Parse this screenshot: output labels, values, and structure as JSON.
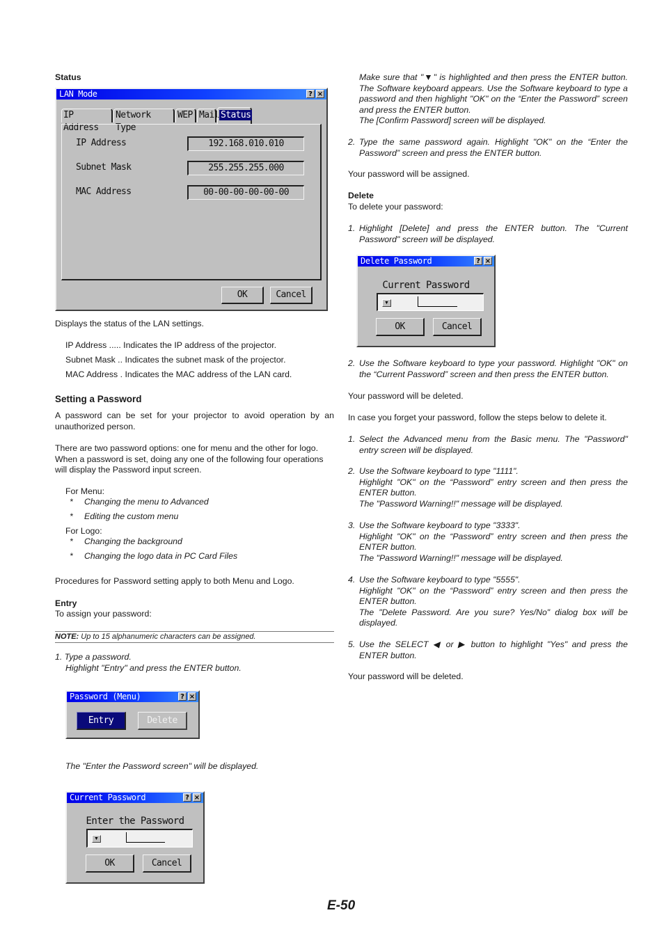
{
  "left": {
    "status_heading": "Status",
    "lan_window": {
      "title": "LAN Mode",
      "help_icon": "?",
      "close_icon": "×",
      "tabs": [
        {
          "label": "IP Address",
          "selected": false
        },
        {
          "label": "Network Type",
          "selected": false
        },
        {
          "label": "WEP",
          "selected": false
        },
        {
          "label": "Mail",
          "selected": false
        },
        {
          "label": "Status",
          "selected": true
        }
      ],
      "rows": [
        {
          "label": "IP Address",
          "value": "192.168.010.010"
        },
        {
          "label": "Subnet Mask",
          "value": "255.255.255.000"
        },
        {
          "label": "MAC Address",
          "value": "00-00-00-00-00-00"
        }
      ],
      "ok_label": "OK",
      "cancel_label": "Cancel"
    },
    "status_desc": "Displays the status of the LAN settings.",
    "defs": [
      {
        "term": "IP Address .....",
        "desc": "Indicates the IP address of the projector."
      },
      {
        "term": "Subnet Mask ..",
        "desc": "Indicates the subnet mask of the projector."
      },
      {
        "term": "MAC Address .",
        "desc": "Indicates the MAC address of the LAN card."
      }
    ],
    "setting_heading": "Setting a Password",
    "setting_p1": "A password can be set for your projector to avoid operation by an unauthorized person.",
    "setting_p2": "There are two password options: one for menu and the other for logo. When a password is set, doing any one of the following four operations will display the Password input screen.",
    "for_menu": "For Menu:",
    "menu_items": [
      "Changing the menu to Advanced",
      "Editing the custom menu"
    ],
    "for_logo": "For Logo:",
    "logo_items": [
      "Changing the background",
      "Changing the logo data in PC Card Files"
    ],
    "bullet": "*",
    "procedures": "Procedures for Password setting apply to both Menu and Logo.",
    "entry_heading": "Entry",
    "entry_sub": "To assign your password:",
    "note_label": "NOTE:",
    "note_text": " Up to 15 alphanumeric characters can be assigned.",
    "step1_line1": "1. Type a password.",
    "step1_line2": "Highlight \"Entry\" and press the ENTER button.",
    "pw_menu_window": {
      "title": "Password (Menu)",
      "entry_label": "Entry",
      "delete_label": "Delete"
    },
    "enter_displayed": "The \"Enter the Password screen\" will be displayed.",
    "current_pw_window": {
      "title": "Current Password",
      "prompt": "Enter the Password",
      "ok_label": "OK",
      "cancel_label": "Cancel"
    }
  },
  "right": {
    "p_make_sure": "Make sure that \"▼\" is highlighted and then press the ENTER button. The Software keyboard appears. Use the Software keyboard to type a password and then highlight \"OK\" on the “Enter the Password” screen and press the ENTER button.",
    "p_confirm": "The [Confirm Password] screen will be displayed.",
    "step2_num": "2.",
    "step2": "Type the same password again. Highlight \"OK\" on the “Enter the Password” screen and press the ENTER button.",
    "assigned": "Your password will be assigned.",
    "delete_heading": "Delete",
    "delete_sub": "To delete your password:",
    "del_step1_num": "1.",
    "del_step1": "Highlight [Delete] and press the ENTER button. The \"Current Password\" screen will be displayed.",
    "delete_window": {
      "title": "Delete Password",
      "prompt": "Current Password",
      "ok_label": "OK",
      "cancel_label": "Cancel"
    },
    "del_step2_num": "2.",
    "del_step2": "Use the Software keyboard to type your password. Highlight \"OK\" on the “Current Password” screen and then press the ENTER button.",
    "deleted1": "Your password will be deleted.",
    "forget": "In case you forget your password, follow the steps below to delete it.",
    "forget_steps": [
      {
        "num": "1.",
        "lines": [
          "Select the Advanced menu from the Basic menu. The \"Password\" entry screen will be displayed."
        ]
      },
      {
        "num": "2.",
        "lines": [
          "Use the Software keyboard to type \"1111\".",
          "Highlight \"OK\" on the “Password” entry screen and then press the ENTER button.",
          "The \"Password Warning!!\" message will be displayed."
        ]
      },
      {
        "num": "3.",
        "lines": [
          "Use the Software keyboard to type \"3333\".",
          "Highlight \"OK\" on the “Password” entry screen and then press the ENTER button.",
          "The \"Password Warning!!\" message will be displayed."
        ]
      },
      {
        "num": "4.",
        "lines": [
          "Use the Software keyboard to type \"5555\".",
          "Highlight \"OK\" on the “Password” entry screen and then press the ENTER button.",
          "The \"Delete Password. Are you sure? Yes/No\" dialog box will be displayed."
        ]
      },
      {
        "num": "5.",
        "lines": [
          "Use the SELECT ◀ or ▶ button to highlight \"Yes\" and press the ENTER button."
        ]
      }
    ],
    "deleted2": "Your password will be deleted."
  },
  "footer": {
    "page_number": "E-50"
  }
}
